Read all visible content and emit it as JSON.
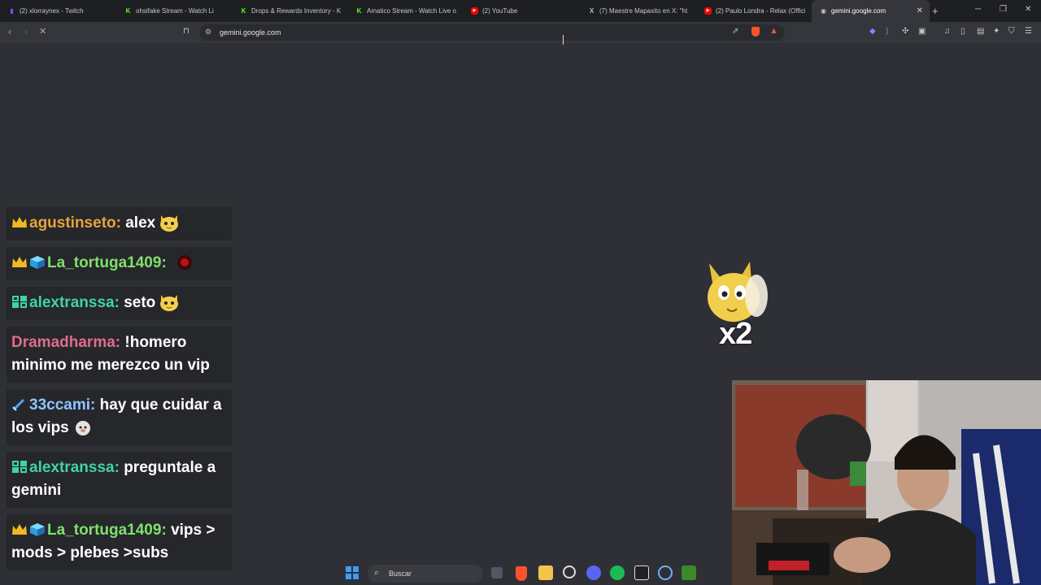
{
  "browser": {
    "tabs": [
      {
        "label": "(2) xlorraynex - Twitch",
        "icon": "twitch-icon",
        "color": "#9146ff"
      },
      {
        "label": "ohsifake Stream - Watch Li",
        "icon": "kick-icon",
        "color": "#53fc18"
      },
      {
        "label": "Drops & Rewards Inventory - K",
        "icon": "kick-icon",
        "color": "#53fc18"
      },
      {
        "label": "Amatico Stream - Watch Live o",
        "icon": "kick-icon",
        "color": "#53fc18"
      },
      {
        "label": "(2) YouTube",
        "icon": "youtube-icon",
        "color": "#ff0000"
      },
      {
        "label": "(7) Maestre Mapaxito en X: \"ht",
        "icon": "x-icon",
        "color": "#ffffff"
      },
      {
        "label": "(2) Paulo Londra - Relax (Offici",
        "icon": "youtube-icon",
        "color": "#ff0000"
      },
      {
        "label": "gemini.google.com",
        "icon": "globe-icon",
        "color": "#c7c8cc"
      }
    ],
    "url": "gemini.google.com"
  },
  "chat": {
    "messages": [
      {
        "user": "agustinseto:",
        "text": "alex",
        "color": "#e8a33d",
        "badges": [
          "crown"
        ],
        "emote": "cat"
      },
      {
        "user": "La_tortuga1409:",
        "text": "",
        "color": "#7fe06d",
        "badges": [
          "crown",
          "cube"
        ],
        "emote": "red"
      },
      {
        "user": "alextranssa:",
        "text": "seto",
        "color": "#3ed3a9",
        "badges": [
          "grid"
        ],
        "emote": "cat"
      },
      {
        "user": "Dramadharma:",
        "text": "!homero minimo me merezco un vip",
        "color": "#e06c8f",
        "badges": [],
        "emote": ""
      },
      {
        "user": "33ccami:",
        "text": "hay que cuidar a los vips",
        "color": "#8fc3ff",
        "badges": [
          "sword"
        ],
        "emote": "dog"
      },
      {
        "user": "alextranssa:",
        "text": "preguntale a gemini",
        "color": "#3ed3a9",
        "badges": [
          "grid"
        ],
        "emote": ""
      },
      {
        "user": "La_tortuga1409:",
        "text": "vips > mods > plebes >subs",
        "color": "#7fe06d",
        "badges": [
          "crown",
          "cube"
        ],
        "emote": ""
      }
    ]
  },
  "overlay": {
    "multiplier": "x2"
  },
  "taskbar": {
    "search_placeholder": "Buscar"
  }
}
